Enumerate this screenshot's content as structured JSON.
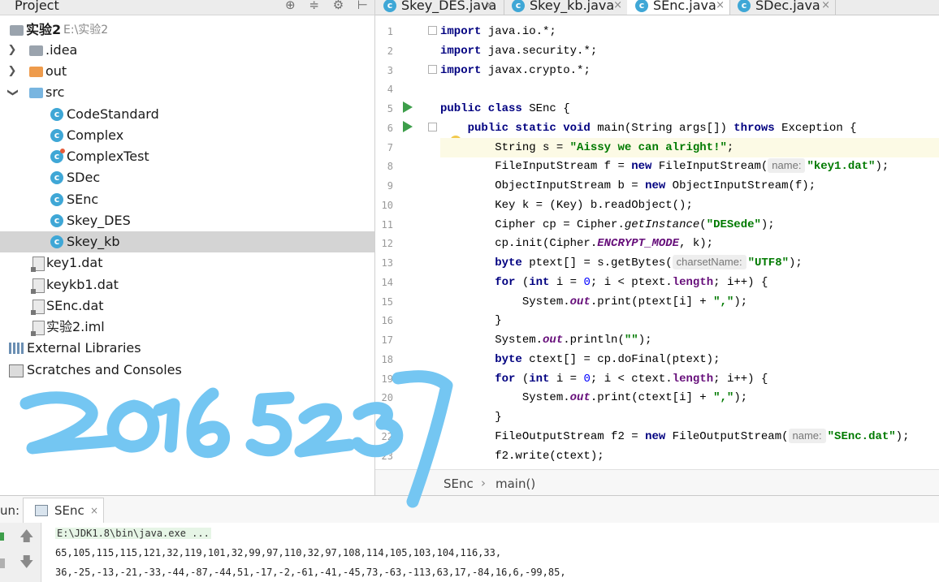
{
  "project_panel": {
    "title": "Project",
    "tools": [
      "⊕",
      "≑",
      "⚙",
      "⊢"
    ],
    "root": {
      "label": "实验2",
      "path": "E:\\实验2"
    },
    "items": [
      {
        "label": ".idea"
      },
      {
        "label": "out"
      },
      {
        "label": "src"
      },
      {
        "label": "CodeStandard"
      },
      {
        "label": "Complex"
      },
      {
        "label": "ComplexTest"
      },
      {
        "label": "SDec"
      },
      {
        "label": "SEnc"
      },
      {
        "label": "Skey_DES"
      },
      {
        "label": "Skey_kb"
      },
      {
        "label": "key1.dat"
      },
      {
        "label": "keykb1.dat"
      },
      {
        "label": "SEnc.dat"
      },
      {
        "label": "实验2.iml"
      },
      {
        "label": "External Libraries"
      },
      {
        "label": "Scratches and Consoles"
      }
    ]
  },
  "editor": {
    "tabs": [
      {
        "label": "Skey_DES.java",
        "close": "×"
      },
      {
        "label": "Skey_kb.java",
        "close": "×"
      },
      {
        "label": "SEnc.java",
        "close": "×"
      },
      {
        "label": "SDec.java",
        "close": "×"
      }
    ],
    "line_numbers": [
      "1",
      "2",
      "3",
      "4",
      "5",
      "6",
      "7",
      "8",
      "9",
      "10",
      "11",
      "12",
      "13",
      "14",
      "15",
      "16",
      "17",
      "18",
      "19",
      "20",
      "21",
      "22",
      "23"
    ],
    "code": {
      "l1_kw": "import",
      "l1_rest": " java.io.*;",
      "l2_kw": "import",
      "l2_rest": " java.security.*;",
      "l3_kw": "import",
      "l3_rest": " javax.crypto.*;",
      "l5_kw": "public class",
      "l5_rest": " SEnc {",
      "l6_kw1": "public static void",
      "l6_mid": " main(String args[]) ",
      "l6_kw2": "throws",
      "l6_rest": " Exception {",
      "l7_a": "String s = ",
      "l7_str": "\"Aissy we can alright!\"",
      "l7_b": ";",
      "l8_a": "FileInputStream f = ",
      "l8_kw": "new",
      "l8_b": " FileInputStream(",
      "l8_hint": "name:",
      "l8_str": "\"key1.dat\"",
      "l8_c": ");",
      "l9_a": "ObjectInputStream b = ",
      "l9_kw": "new",
      "l9_b": " ObjectInputStream(f);",
      "l10": "Key k = (Key) b.readObject();",
      "l11_a": "Cipher cp = Cipher.",
      "l11_it": "getInstance",
      "l11_b": "(",
      "l11_str": "\"DESede\"",
      "l11_c": ");",
      "l12_a": "cp.init(Cipher.",
      "l12_fld": "ENCRYPT_MODE",
      "l12_b": ", k);",
      "l13_kw": "byte",
      "l13_a": " ptext[] = s.getBytes(",
      "l13_hint": "charsetName:",
      "l13_str": "\"UTF8\"",
      "l13_b": ");",
      "l14_kw1": "for",
      "l14_a": " (",
      "l14_kw2": "int",
      "l14_b": " i = ",
      "l14_num": "0",
      "l14_c": "; i < ptext.",
      "l14_fld": "length",
      "l14_d": "; i++) {",
      "l15_a": "System.",
      "l15_fld": "out",
      "l15_b": ".print(ptext[i] + ",
      "l15_str": "\",\"",
      "l15_c": ");",
      "l16": "}",
      "l17_a": "System.",
      "l17_fld": "out",
      "l17_b": ".println(",
      "l17_str": "\"\"",
      "l17_c": ");",
      "l18_kw": "byte",
      "l18_a": " ctext[] = cp.doFinal(ptext);",
      "l19_kw1": "for",
      "l19_a": " (",
      "l19_kw2": "int",
      "l19_b": " i = ",
      "l19_num": "0",
      "l19_c": "; i < ctext.",
      "l19_fld": "length",
      "l19_d": "; i++) {",
      "l20_a": "System.",
      "l20_fld": "out",
      "l20_b": ".print(ctext[i] + ",
      "l20_str": "\",\"",
      "l20_c": ");",
      "l21": "}",
      "l22_a": "FileOutputStream f2 = ",
      "l22_kw": "new",
      "l22_b": " FileOutputStream(",
      "l22_hint": "name:",
      "l22_str": "\"SEnc.dat\"",
      "l22_c": ");",
      "l23": "f2.write(ctext);"
    },
    "breadcrumb": {
      "class": "SEnc",
      "separator": "›",
      "method": "main()"
    }
  },
  "run_panel": {
    "label": "un:",
    "tab": {
      "label": "SEnc",
      "close": "×"
    },
    "toolbar": {
      "up": "🡅",
      "down": "🡇"
    },
    "output": [
      "E:\\JDK1.8\\bin\\java.exe ...",
      "65,105,115,115,121,32,119,101,32,99,97,110,32,97,108,114,105,103,104,116,33,",
      "36,-25,-13,-21,-33,-44,-87,-44,51,-17,-2,-61,-41,-45,73,-63,-113,63,17,-84,16,6,-99,85,"
    ]
  },
  "colors": {
    "keyword": "#000080",
    "string": "#007a00",
    "field": "#660e7a",
    "handwriting": "#74c6f2",
    "run_icon": "#3d9e4a"
  }
}
